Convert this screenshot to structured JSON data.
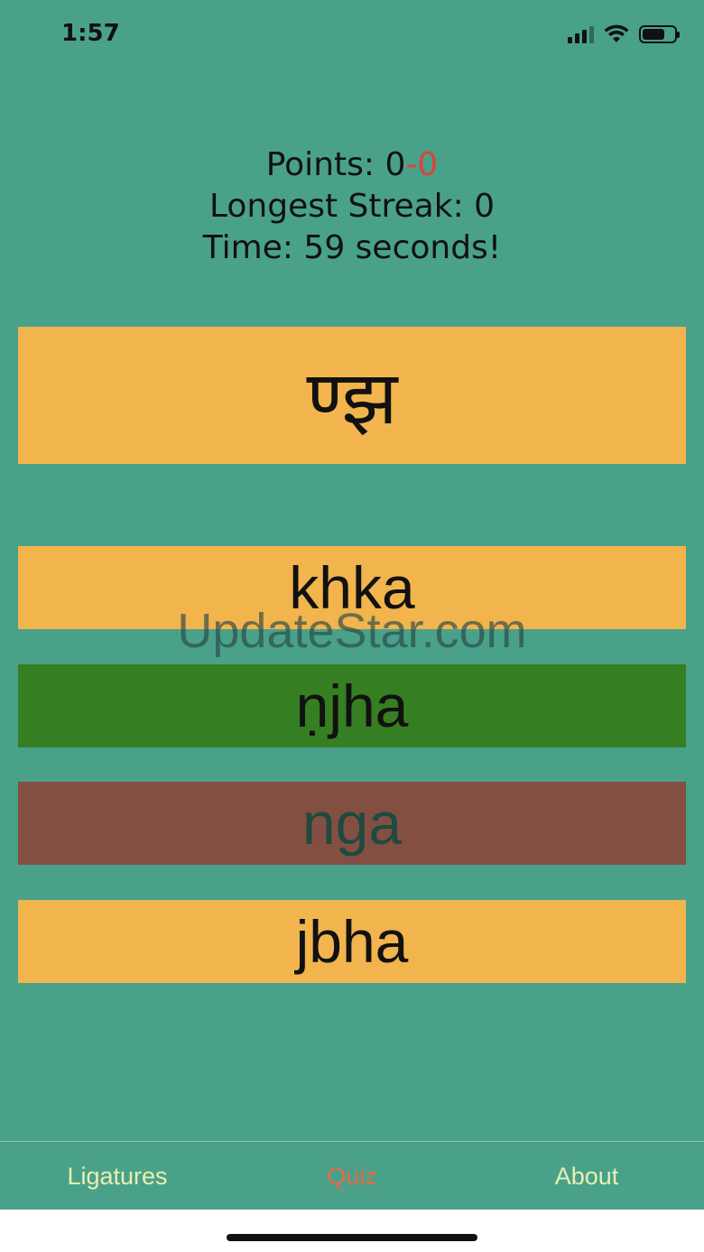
{
  "status_bar": {
    "time": "1:57",
    "icons": [
      "signal-icon",
      "wifi-icon",
      "battery-icon"
    ],
    "battery_level": 0.7
  },
  "stats": {
    "points_label": "Points: ",
    "points_correct": "0",
    "points_separator": "-",
    "points_wrong": "0",
    "streak": "Longest Streak: 0",
    "time": "Time: 59 seconds!"
  },
  "question": {
    "glyph": "ण्झ"
  },
  "answers": [
    {
      "label": "khka",
      "state": "neutral"
    },
    {
      "label": "ṇjha",
      "state": "correct"
    },
    {
      "label": "nga",
      "state": "wrong"
    },
    {
      "label": "jbha",
      "state": "neutral"
    }
  ],
  "watermark": "UpdateStar.com",
  "tabs": [
    {
      "label": "Ligatures",
      "active": false
    },
    {
      "label": "Quiz",
      "active": true
    },
    {
      "label": "About",
      "active": false
    }
  ],
  "colors": {
    "background": "#4aa18a",
    "card": "#f2b44d",
    "correct": "#367e22",
    "wrong": "#844f43",
    "accent": "#e46a44",
    "tab_text": "#e7f0b0"
  }
}
